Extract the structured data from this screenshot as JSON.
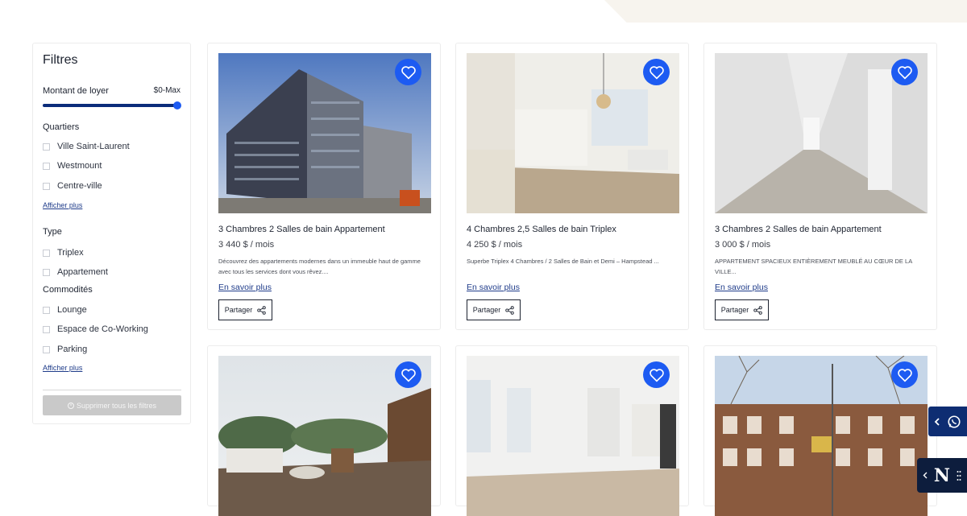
{
  "sidebar": {
    "title": "Filtres",
    "rent": {
      "label": "Montant de loyer",
      "value": "$0-Max"
    },
    "neighborhoods": {
      "title": "Quartiers",
      "items": [
        "Ville Saint-Laurent",
        "Westmount",
        "Centre-ville"
      ],
      "show_more": "Afficher plus"
    },
    "type": {
      "title": "Type",
      "items": [
        "Triplex",
        "Appartement"
      ]
    },
    "amenities": {
      "title": "Commodités",
      "items": [
        "Lounge",
        "Espace de Co-Working",
        "Parking"
      ],
      "show_more": "Afficher plus"
    },
    "clear_all": "Supprimer tous les filtres"
  },
  "listings": [
    {
      "title": "3 Chambres 2 Salles de bain Appartement",
      "price": "3 440 $ / mois",
      "description": "Découvrez des appartements modernes dans un immeuble haut de gamme avec tous les services dont vous rêvez....",
      "link": "En savoir plus",
      "share": "Partager"
    },
    {
      "title": "4 Chambres 2,5 Salles de bain Triplex",
      "price": "4 250 $ / mois",
      "description": "Superbe Triplex 4 Chambres / 2 Salles de Bain et Demi – Hampstead ...",
      "link": "En savoir plus",
      "share": "Partager"
    },
    {
      "title": "3 Chambres 2 Salles de bain Appartement",
      "price": "3 000 $ / mois",
      "description": "APPARTEMENT SPACIEUX ENTIÈREMENT MEUBLÉ AU CŒUR DE LA VILLE...",
      "link": "En savoir plus",
      "share": "Partager"
    }
  ],
  "widgets": {
    "logo_letter": "N"
  },
  "colors": {
    "accent": "#1d5bf2",
    "navy": "#0e2d72",
    "link": "#1f3c8a"
  }
}
